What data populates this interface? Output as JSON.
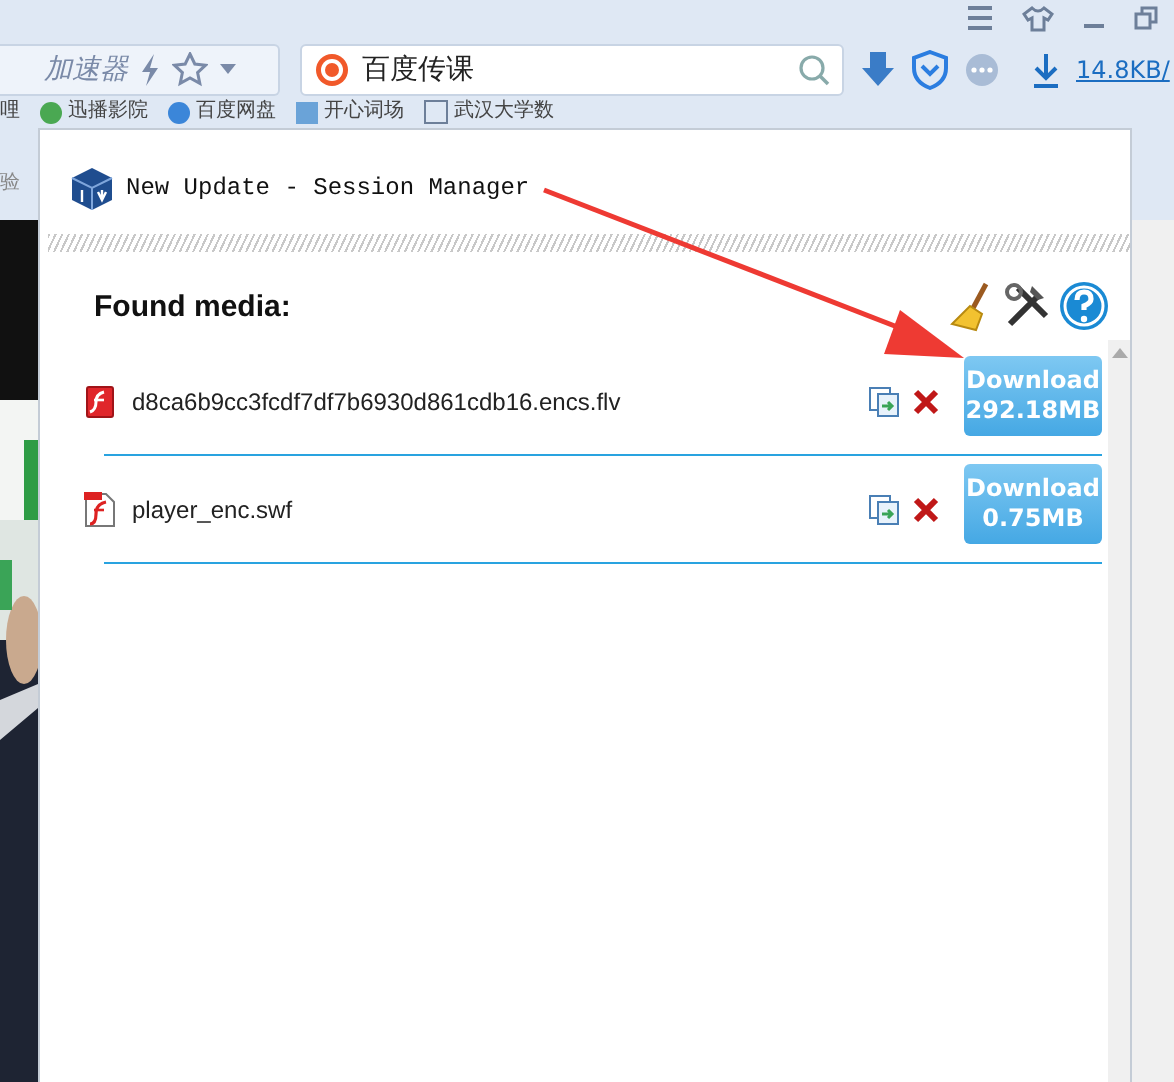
{
  "browser": {
    "address_text": "加速器",
    "search_value": "百度传课",
    "download_speed": "14.8KB/",
    "bookmarks": [
      {
        "label": "哩"
      },
      {
        "label": "迅播影院"
      },
      {
        "label": "百度网盘"
      },
      {
        "label": "开心词场"
      },
      {
        "label": "武汉大学数"
      }
    ],
    "side_text": "验"
  },
  "popup": {
    "title": "New Update - Session Manager",
    "heading": "Found media:",
    "media": [
      {
        "name": "d8ca6b9cc3fcdf7df7b6930d861cdb16.encs.flv",
        "kind": "video",
        "download_label": "Download",
        "size": "292.18MB"
      },
      {
        "name": "player_enc.swf",
        "kind": "flash",
        "download_label": "Download",
        "size": "0.75MB"
      }
    ]
  }
}
